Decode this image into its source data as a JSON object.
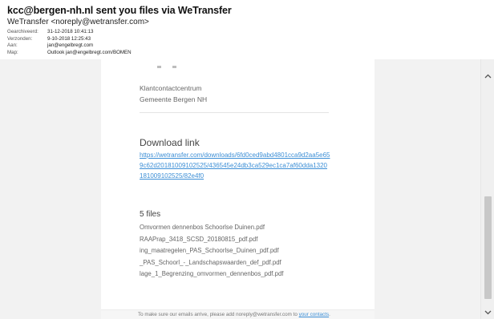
{
  "email": {
    "subject": "kcc@bergen-nh.nl sent you files via WeTransfer",
    "sender": "WeTransfer <noreply@wetransfer.com>",
    "meta": [
      {
        "key": "Gearchiveerd:",
        "value": "31-12-2018 10:41:13"
      },
      {
        "key": "Verzonden:",
        "value": "9-10-2018 12:25:43"
      },
      {
        "key": "Aan:",
        "value": "jan@engelbregt.com"
      },
      {
        "key": "Map:",
        "value": "Outlook jan@engelbregt.com/BOMEN"
      }
    ]
  },
  "card": {
    "org_line1": "Klantcontactcentrum",
    "org_line2": "Gemeente Bergen NH",
    "download_title": "Download link",
    "download_url": "https://wetransfer.com/downloads/6fd0ced9abd4801cca9d2aa5e659c62d20181009102525/436545e24db3ca529ec1ca7af60dda1320181009102525/82e4f0",
    "files_title": "5 files",
    "files": [
      "Omvormen dennenbos Schoorlse Duinen.pdf",
      "RAAPrap_3418_SCSD_20180815_pdf.pdf",
      "ing_maatregelen_PAS_Schoorlse_Duinen_pdf.pdf",
      "_PAS_Schoorl_-_Landschapswaarden_def_pdf.pdf",
      "lage_1_Begrenzing_omvormen_dennenbos_pdf.pdf"
    ],
    "footer_text": "To make sure our emails arrive, please add noreply@wetransfer.com to",
    "footer_link": "your contacts"
  },
  "scrollbar": {
    "up_icon": "chevron-up-icon",
    "down_icon": "chevron-down-icon"
  }
}
